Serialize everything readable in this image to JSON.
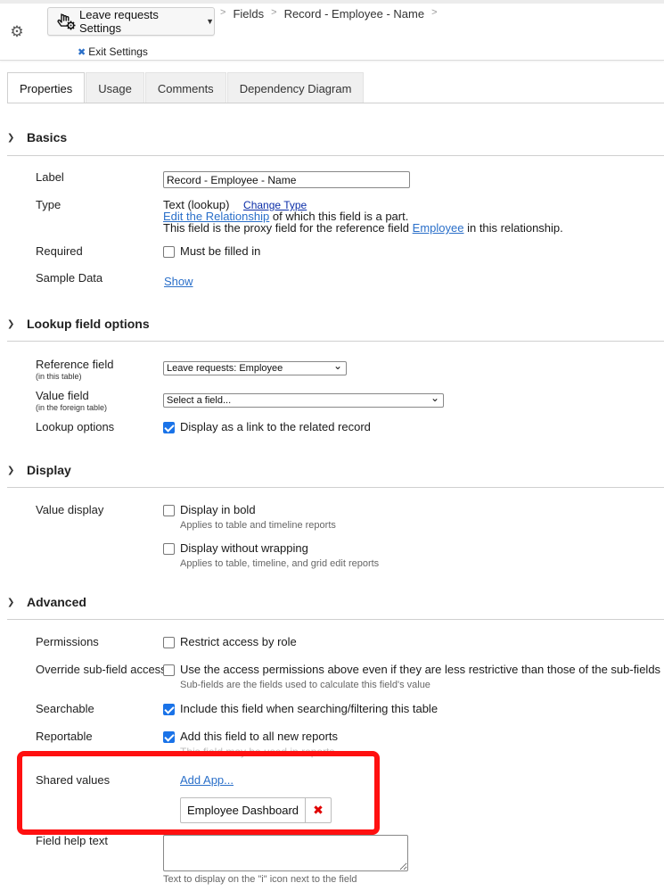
{
  "header": {
    "settings_button": "Leave requests Settings",
    "exit_settings": "Exit Settings",
    "breadcrumbs": [
      "Fields",
      "Record - Employee - Name"
    ]
  },
  "tabs": [
    "Properties",
    "Usage",
    "Comments",
    "Dependency Diagram"
  ],
  "sections": {
    "basics": "Basics",
    "lookup": "Lookup field options",
    "display": "Display",
    "advanced": "Advanced"
  },
  "basics": {
    "label_label": "Label",
    "label_value": "Record - Employee - Name",
    "type_label": "Type",
    "type_value": "Text (lookup)",
    "change_type": "Change Type",
    "edit_relationship": "Edit the Relationship",
    "relationship_suffix": "of which this field is a part.",
    "proxy_prefix": "This field is the proxy field for the reference field",
    "proxy_link": "Employee",
    "proxy_suffix": "in this relationship.",
    "required_label": "Required",
    "required_cb": "Must be filled in",
    "sample_label": "Sample Data",
    "sample_show": "Show"
  },
  "lookup": {
    "ref_label": "Reference field",
    "ref_sub": "(in this table)",
    "ref_value": "Leave requests: Employee",
    "value_label": "Value field",
    "value_sub": "(in the foreign table)",
    "value_value": "Select a field...",
    "options_label": "Lookup options",
    "options_cb": "Display as a link to the related record"
  },
  "display": {
    "value_display_label": "Value display",
    "bold_cb": "Display in bold",
    "bold_note": "Applies to table and timeline reports",
    "nowrap_cb": "Display without wrapping",
    "nowrap_note": "Applies to table, timeline, and grid edit reports"
  },
  "advanced": {
    "permissions_label": "Permissions",
    "permissions_cb": "Restrict access by role",
    "override_label": "Override sub-field access",
    "override_cb": "Use the access permissions above even if they are less restrictive than those of the sub-fields",
    "override_note": "Sub-fields are the fields used to calculate this field's value",
    "searchable_label": "Searchable",
    "searchable_cb": "Include this field when searching/filtering this table",
    "reportable_label": "Reportable",
    "reportable_cb": "Add this field to all new reports",
    "reportable_faded": "This field may be used in reports",
    "shared_label": "Shared values",
    "add_app": "Add App...",
    "shared_app": "Employee Dashboard",
    "help_label": "Field help text",
    "help_note": "Text to display on the \"i\" icon next to the field"
  },
  "colors": {
    "accent": "#1a73e8",
    "link": "#2a6fc9",
    "highlight_box": "#ff1010",
    "delete": "#e00000"
  }
}
